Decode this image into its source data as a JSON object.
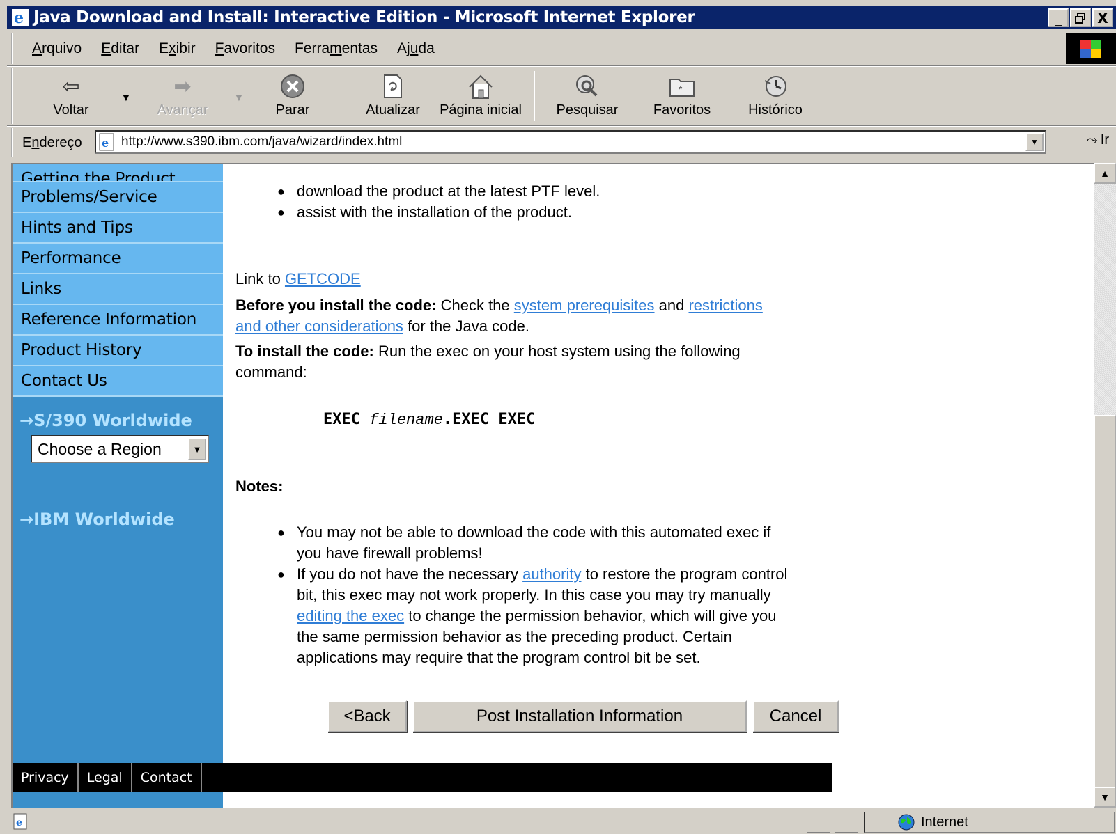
{
  "window": {
    "title": "Java Download and Install: Interactive Edition - Microsoft Internet Explorer",
    "controls": {
      "minimize": "_",
      "maximize": "🗗",
      "close": "X"
    }
  },
  "menu": [
    {
      "pre": "",
      "u": "A",
      "post": "rquivo"
    },
    {
      "pre": "",
      "u": "E",
      "post": "ditar"
    },
    {
      "pre": "E",
      "u": "x",
      "post": "ibir"
    },
    {
      "pre": "",
      "u": "F",
      "post": "avoritos"
    },
    {
      "pre": "Ferra",
      "u": "m",
      "post": "entas"
    },
    {
      "pre": "Aj",
      "u": "u",
      "post": "da"
    }
  ],
  "toolbar": {
    "back": "Voltar",
    "forward": "Avançar",
    "stop": "Parar",
    "refresh": "Atualizar",
    "home": "Página inicial",
    "search": "Pesquisar",
    "favorites": "Favoritos",
    "history": "Histórico"
  },
  "address": {
    "label_pre": "E",
    "label_u": "n",
    "label_post": "dereço",
    "url": "http://www.s390.ibm.com/java/wizard/index.html",
    "go": "Ir"
  },
  "nav": {
    "items": [
      "Getting the Product",
      "Problems/Service",
      "Hints and Tips",
      "Performance",
      "Links",
      "Reference Information",
      "Product History",
      "Contact Us"
    ],
    "region_heading": "S/390 Worldwide",
    "region_select": "Choose a Region",
    "ibm_heading": "IBM Worldwide"
  },
  "footer": [
    "Privacy",
    "Legal",
    "Contact"
  ],
  "content": {
    "bullets_top": [
      "download the product at the latest PTF level.",
      "assist with the installation of the product."
    ],
    "link_prefix": "Link to ",
    "getcode": "GETCODE",
    "before_bold": "Before you install the code:",
    "before_text1": " Check the ",
    "before_link1": "system prerequisites",
    "before_text2": " and ",
    "before_link2_a": "restrictions",
    "before_link2_b": "and other considerations",
    "before_text3": " for the Java code.",
    "install_bold": "To install the code:",
    "install_text_a": " Run the exec on your host system using the following",
    "install_text_b": "command:",
    "code_exec": "EXEC ",
    "code_file": "filename",
    "code_rest": ".EXEC EXEC",
    "notes_heading": "Notes:",
    "note1_a": "You may not be able to download the code with this automated exec if",
    "note1_b": "you have firewall problems!",
    "note2_a1": "If you do not have the necessary ",
    "note2_link1": "authority",
    "note2_a2": " to restore the program control",
    "note2_b": "bit, this exec may not work properly. In this case you may try manually",
    "note2_link2": "editing the exec",
    "note2_c": " to change the permission behavior, which will give you",
    "note2_d": "the same permission behavior as the preceding product. Certain",
    "note2_e": "applications may require that the program control bit be set."
  },
  "buttons": {
    "back": "<Back",
    "post": "Post Installation Information",
    "cancel": "Cancel"
  },
  "status": {
    "zone": "Internet"
  }
}
